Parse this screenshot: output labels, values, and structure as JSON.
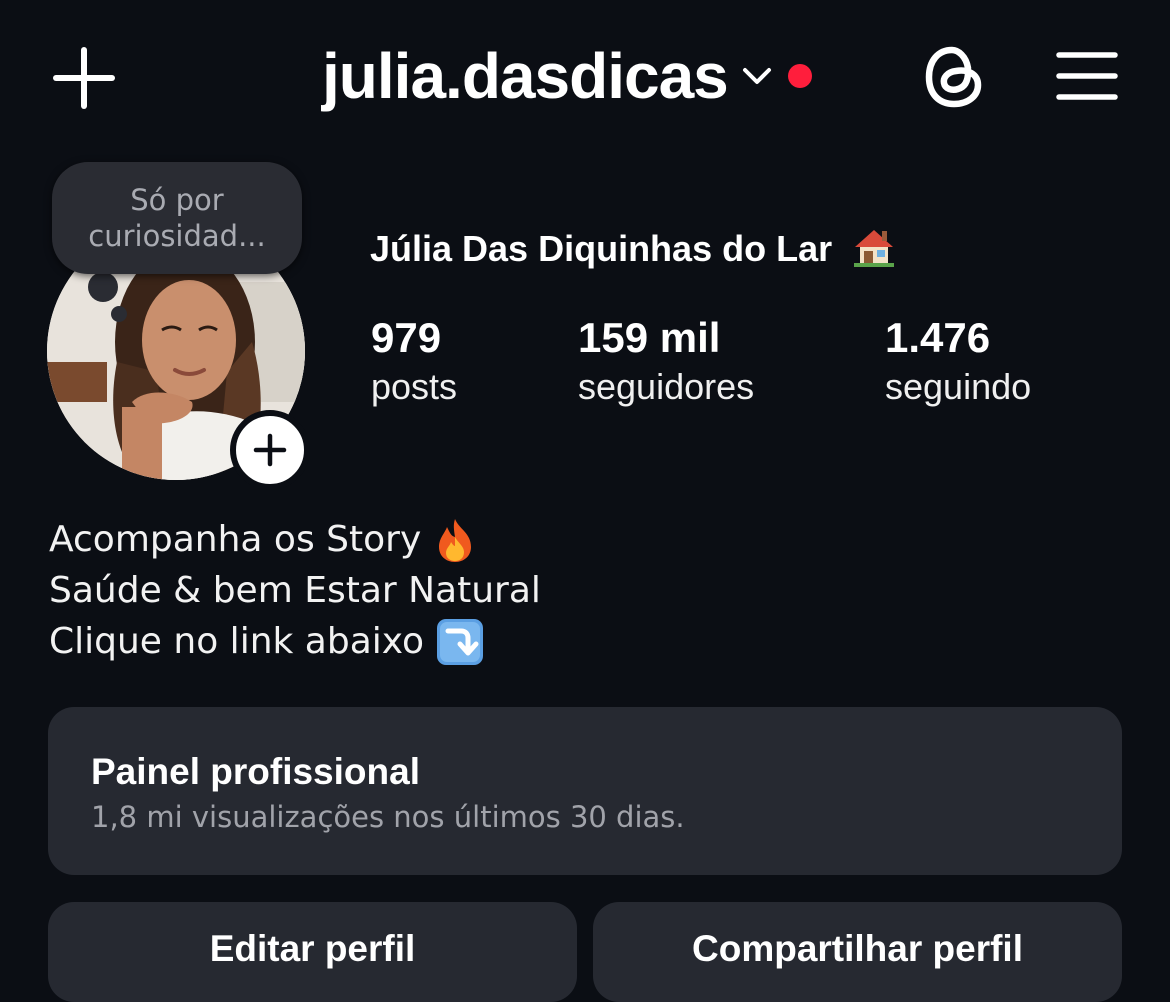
{
  "header": {
    "username": "julia.dasdicas",
    "new_post_icon": "plus-icon",
    "switch_account_icon": "chevron-down-icon",
    "notification_dot_color": "#ff1e3c",
    "threads_icon": "threads-icon",
    "menu_icon": "hamburger-menu-icon"
  },
  "note": {
    "text": "Só por curiosidad..."
  },
  "profile": {
    "display_name": "Júlia Das Diquinhas do Lar",
    "display_name_emoji": "house-emoji",
    "stats": [
      {
        "value": "979",
        "label": "posts"
      },
      {
        "value": "159 mil",
        "label": "seguidores"
      },
      {
        "value": "1.476",
        "label": "seguindo"
      }
    ]
  },
  "bio": {
    "lines": [
      {
        "text": "Acompanha os Story",
        "emoji": "fire-emoji"
      },
      {
        "text": "Saúde & bem Estar Natural",
        "emoji": ""
      },
      {
        "text": "Clique no link abaixo",
        "emoji": "arrow-down-right-emoji"
      }
    ]
  },
  "professional_dashboard": {
    "title": "Painel profissional",
    "subtitle": "1,8 mi visualizações nos últimos 30 dias."
  },
  "actions": {
    "edit_profile": "Editar perfil",
    "share_profile": "Compartilhar perfil"
  }
}
